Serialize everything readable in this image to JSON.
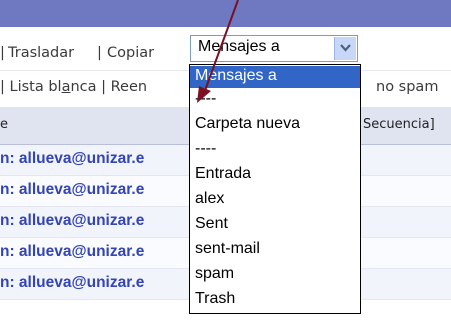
{
  "toolbar_top": {
    "links": [
      "Trasladar",
      "|",
      "Copiar"
    ]
  },
  "toolbar_second": {
    "text_left": "| Lista bl",
    "underline_char": "a",
    "text_after": "nca | Reen",
    "text_right": "no spam"
  },
  "table_header": {
    "col1": "e",
    "col2": "Secuencia]"
  },
  "rows": [
    "n: allueva@unizar.e",
    "n: allueva@unizar.e",
    "n: allueva@unizar.e",
    "n: allueva@unizar.e",
    "n: allueva@unizar.e"
  ],
  "select": {
    "value": "Mensajes a",
    "arrow_icon": "chevron-down-icon"
  },
  "dropdown": {
    "options": [
      "Mensajes a",
      "----",
      "Carpeta nueva",
      "----",
      "Entrada",
      "alex",
      "Sent",
      "sent-mail",
      "spam",
      "Trash"
    ],
    "selected_index": 0
  },
  "colors": {
    "top_band": "#6f79c2",
    "selected_option": "#3166c6",
    "link_text": "#3344b4",
    "pointer_arrow": "#7a1020"
  }
}
